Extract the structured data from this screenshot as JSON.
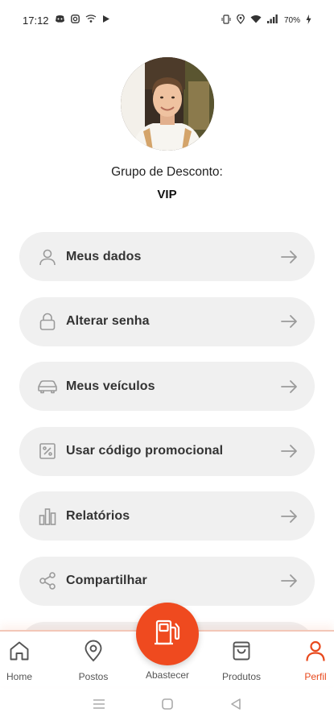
{
  "status_bar": {
    "time": "17:12",
    "battery": "70%",
    "left_icons": [
      "discord-icon",
      "instagram-icon",
      "wifi-calling-icon",
      "play-icon"
    ],
    "right_icons": [
      "vibrate-icon",
      "location-icon",
      "wifi-icon",
      "signal-icon",
      "battery-icon"
    ]
  },
  "profile": {
    "group_label": "Grupo de Desconto:",
    "group_value": "VIP"
  },
  "menu": {
    "items": [
      {
        "label": "Meus dados",
        "icon": "user-icon"
      },
      {
        "label": "Alterar senha",
        "icon": "lock-icon"
      },
      {
        "label": "Meus veículos",
        "icon": "car-icon"
      },
      {
        "label": "Usar código promocional",
        "icon": "percent-icon"
      },
      {
        "label": "Relatórios",
        "icon": "bar-chart-icon"
      },
      {
        "label": "Compartilhar",
        "icon": "share-icon"
      }
    ]
  },
  "bottom_nav": {
    "items": [
      {
        "label": "Home",
        "icon": "home-icon"
      },
      {
        "label": "Postos",
        "icon": "map-pin-icon"
      },
      {
        "label": "Abastecer",
        "icon": "fuel-pump-icon"
      },
      {
        "label": "Produtos",
        "icon": "shopping-bag-icon"
      },
      {
        "label": "Perfil",
        "icon": "user-icon",
        "active": true
      }
    ]
  },
  "colors": {
    "accent": "#ef4a1f",
    "menu_bg": "#f0f0f0",
    "icon_gray": "#9a9a9a"
  }
}
